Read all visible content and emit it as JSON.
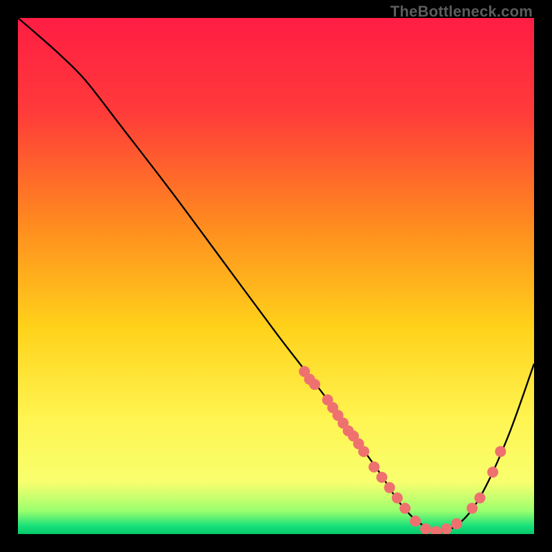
{
  "watermark": "TheBottleneck.com",
  "chart_data": {
    "type": "line",
    "title": "",
    "xlabel": "",
    "ylabel": "",
    "xlim": [
      0,
      100
    ],
    "ylim": [
      0,
      100
    ],
    "grid": false,
    "legend": false,
    "gradient_stops": [
      {
        "offset": 0.0,
        "color": "#ff1d44"
      },
      {
        "offset": 0.18,
        "color": "#ff3a3a"
      },
      {
        "offset": 0.4,
        "color": "#ff8b1f"
      },
      {
        "offset": 0.6,
        "color": "#ffd21a"
      },
      {
        "offset": 0.78,
        "color": "#fff552"
      },
      {
        "offset": 0.9,
        "color": "#f8ff6e"
      },
      {
        "offset": 0.955,
        "color": "#9bff6e"
      },
      {
        "offset": 0.985,
        "color": "#16e07a"
      },
      {
        "offset": 1.0,
        "color": "#06c96a"
      }
    ],
    "series": [
      {
        "name": "bottleneck-curve",
        "color": "#000000",
        "x": [
          0.0,
          3.5,
          8.0,
          13.0,
          20.0,
          30.0,
          40.0,
          50.0,
          55.0,
          60.0,
          65.0,
          70.0,
          74.0,
          78.0,
          82.0,
          86.0,
          90.0,
          95.0,
          100.0
        ],
        "y": [
          100.0,
          97.0,
          93.0,
          88.0,
          79.0,
          66.0,
          52.5,
          39.0,
          32.5,
          26.0,
          19.0,
          12.0,
          6.0,
          2.0,
          0.5,
          2.5,
          8.0,
          19.0,
          33.0
        ]
      }
    ],
    "scatter": {
      "name": "highlight-points",
      "color": "#ee7170",
      "radius": 8,
      "points": [
        {
          "x": 55.5,
          "y": 31.5
        },
        {
          "x": 56.5,
          "y": 30.0
        },
        {
          "x": 57.5,
          "y": 29.0
        },
        {
          "x": 60.0,
          "y": 26.0
        },
        {
          "x": 61.0,
          "y": 24.5
        },
        {
          "x": 62.0,
          "y": 23.0
        },
        {
          "x": 63.0,
          "y": 21.5
        },
        {
          "x": 64.0,
          "y": 20.0
        },
        {
          "x": 65.0,
          "y": 19.0
        },
        {
          "x": 66.0,
          "y": 17.5
        },
        {
          "x": 67.0,
          "y": 16.0
        },
        {
          "x": 69.0,
          "y": 13.0
        },
        {
          "x": 70.5,
          "y": 11.0
        },
        {
          "x": 72.0,
          "y": 9.0
        },
        {
          "x": 73.5,
          "y": 7.0
        },
        {
          "x": 75.0,
          "y": 5.0
        },
        {
          "x": 77.0,
          "y": 2.5
        },
        {
          "x": 79.0,
          "y": 1.0
        },
        {
          "x": 81.0,
          "y": 0.5
        },
        {
          "x": 83.0,
          "y": 1.0
        },
        {
          "x": 85.0,
          "y": 2.0
        },
        {
          "x": 88.0,
          "y": 5.0
        },
        {
          "x": 89.5,
          "y": 7.0
        },
        {
          "x": 92.0,
          "y": 12.0
        },
        {
          "x": 93.5,
          "y": 16.0
        }
      ]
    }
  }
}
